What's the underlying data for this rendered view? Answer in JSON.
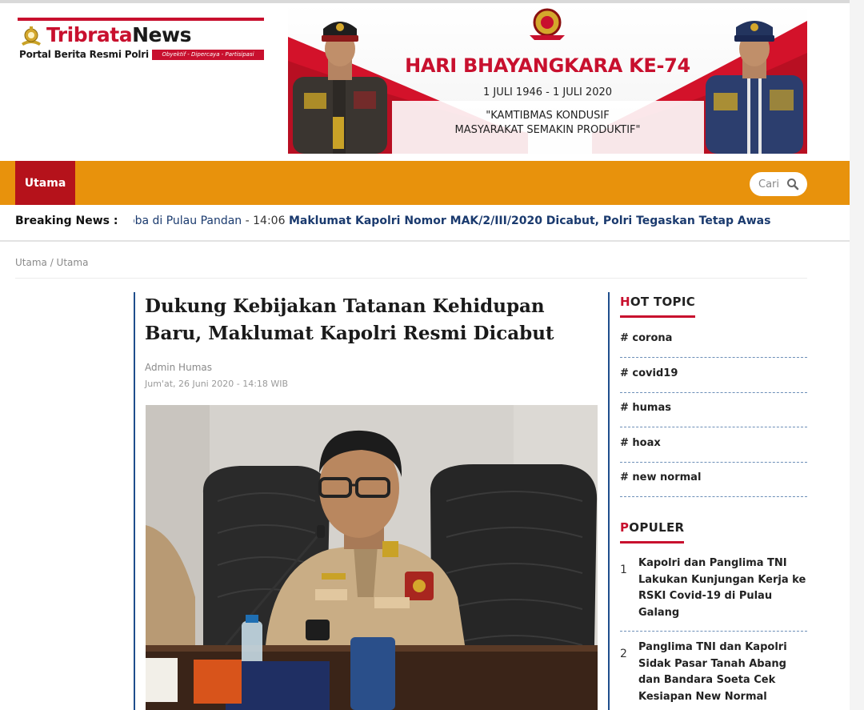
{
  "brand": {
    "name_part1": "Tribrata",
    "name_part2": "News",
    "subtitle": "Portal Berita Resmi Polri",
    "tagline": "Obyektif - Dipercaya - Partisipasi",
    "badge_icon": "police-emblem-icon"
  },
  "banner": {
    "title": "HARI BHAYANGKARA KE-74",
    "dates": "1 JULI 1946 - 1 JULI 2020",
    "quote_line1": "\"KAMTIBMAS KONDUSIF",
    "quote_line2": "MASYARAKAT SEMAKIN PRODUKTIF\""
  },
  "nav": {
    "home_label": "Utama",
    "search_placeholder": "Cari",
    "search_icon": "magnifier-icon"
  },
  "breaking": {
    "label": "Breaking News :",
    "item1_tail": "oba di Pulau Pandan",
    "separator": " - ",
    "item1_time": "14:06",
    "item2_title": "Maklumat Kapolri Nomor MAK/2/III/2020 Dicabut, Polri Tegaskan Tetap Awas"
  },
  "breadcrumb": "Utama / Utama",
  "article": {
    "title": "Dukung Kebijakan Tatanan Kehidupan Baru, Maklumat Kapolri Resmi Dicabut",
    "author": "Admin Humas",
    "date": "Jum'at, 26 Juni 2020 - 14:18 WIB"
  },
  "sidebar": {
    "hot_topic_first": "H",
    "hot_topic_rest": "OT TOPIC",
    "topics": [
      "# corona",
      "# covid19",
      "# humas",
      "# hoax",
      "# new normal"
    ],
    "popular_first": "P",
    "popular_rest": "OPULER",
    "popular": [
      {
        "num": "1",
        "title": "Kapolri dan Panglima TNI Lakukan Kunjungan Kerja ke RSKI Covid-19 di Pulau Galang"
      },
      {
        "num": "2",
        "title": "Panglima TNI dan Kapolri Sidak Pasar Tanah Abang dan Bandara Soeta Cek Kesiapan New Normal"
      }
    ]
  },
  "colors": {
    "nav_orange": "#e8920c",
    "brand_red": "#c8102e",
    "home_tab_red": "#b5121b",
    "accent_blue": "#1f4e8c"
  }
}
